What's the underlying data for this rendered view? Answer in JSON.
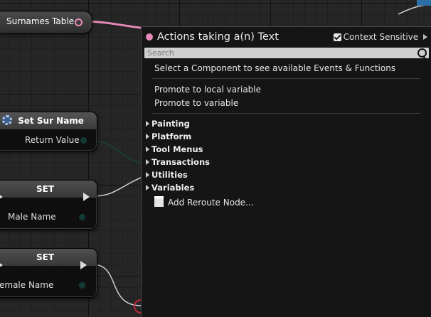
{
  "nodes": {
    "surnames": {
      "label": "Surnames Table"
    },
    "set_sur_name": {
      "title": "Set Sur Name",
      "output": "Return Value"
    },
    "set_male": {
      "title": "SET",
      "output": "Male Name"
    },
    "set_female": {
      "title": "SET",
      "output": "emale Name"
    }
  },
  "menu": {
    "title": "Actions taking a(n) Text",
    "context_sensitive": "Context Sensitive",
    "search_placeholder": "Search",
    "info": "Select a Component to see available Events & Functions",
    "promote_local": "Promote to local variable",
    "promote": "Promote to variable",
    "categories": [
      "Painting",
      "Platform",
      "Tool Menus",
      "Transactions",
      "Utilities",
      "Variables"
    ],
    "add_reroute": "Add Reroute Node..."
  },
  "colors": {
    "text_pin": "#e88ab9",
    "exec_pin": "#dcdcdc",
    "badge": "#2c6ea5"
  }
}
